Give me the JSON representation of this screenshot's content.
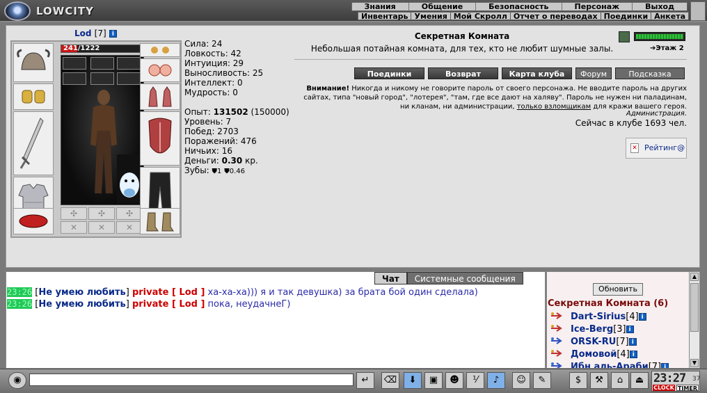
{
  "app": {
    "logo": "LOWCITY"
  },
  "menu_top": [
    "Знания",
    "Общение",
    "Безопасность",
    "Персонаж",
    "Выход"
  ],
  "menu_sub": [
    "Инвентарь",
    "Умения",
    "Мой Скролл",
    "Отчет о переводах",
    "Поединки",
    "Анкета"
  ],
  "character": {
    "name": "Lod",
    "level": "[7]",
    "hp_text": "241/1222",
    "hp_fraction": 0.197,
    "stats": {
      "strength": "Сила: 24",
      "agility": "Ловкость: 42",
      "intuition": "Интуиция: 29",
      "endurance": "Выносливость: 25",
      "intellect": "Интеллект: 0",
      "wisdom": "Мудрость: 0"
    },
    "exp_label": "Опыт: ",
    "exp_value": "131502",
    "exp_next": " (150000)",
    "level_line": "Уровень: 7",
    "wins": "Побед: 2703",
    "losses": "Поражений: 476",
    "draws": "Ничьих: 16",
    "money_label": "Деньги: ",
    "money_value": "0.30",
    "money_unit": " кр.",
    "teeth_label": "Зубы: ",
    "teeth_a": "1",
    "teeth_b": "0.46"
  },
  "room": {
    "title": "Секретная Комната",
    "description": "Небольшая потайная комната, для тех, кто не любит шумные залы.",
    "floor": "Этаж 2"
  },
  "nav_buttons": [
    "Поединки",
    "Возврат",
    "Карта клуба",
    "Форум",
    "Подсказка"
  ],
  "warning": {
    "lead": "Внимание!",
    "text1": " Никогда и никому не говорите пароль от своего персонажа. Не вводите пароль на других сайтах, типа \"новый город\", \"лотерея\", \"там, где все дают на халяву\". Пароль не нужен ни паладинам, ни кланам, ни администрации, ",
    "link": "только взломщикам",
    "text2": " для кражи вашего героя.",
    "signature": "Администрация."
  },
  "online": "Сейчас в клубе 1693 чел.",
  "rating": "Рейтинг@",
  "chat": {
    "tabs": [
      "Чат",
      "Системные сообщения"
    ],
    "lines": [
      {
        "time": "23:26",
        "nick": "Не умею любить",
        "private": "private [ Lod ]",
        "msg": " ха-ха-ха))) я и так девушка) за брата бой один сделала)"
      },
      {
        "time": "23:26",
        "nick": "Не умею любить",
        "private": "private [ Lod ]",
        "msg": " пока, неудачнеГ)"
      }
    ]
  },
  "users_panel": {
    "refresh": "Обновить",
    "room_label": "Секретная Комната (6)",
    "users": [
      {
        "name": "Dart-Sirius",
        "level": "[4]"
      },
      {
        "name": "Ice-Berg",
        "level": "[3]"
      },
      {
        "name": "ORSK-RU",
        "level": "[7]"
      },
      {
        "name": "Домовой",
        "level": "[4]"
      },
      {
        "name": "Ибн аль-Араби",
        "level": "[7]"
      }
    ]
  },
  "clock": {
    "time": "23:27",
    "seconds": "37",
    "label_clock": "CLOCK",
    "label_timer": "TIMER"
  },
  "colors": {
    "accent_nick": "#0a2a8a",
    "private": "#cc0000",
    "timestamp_bg": "#22c85a"
  }
}
